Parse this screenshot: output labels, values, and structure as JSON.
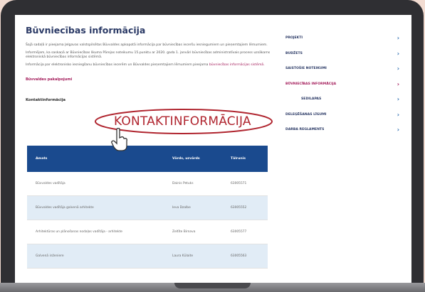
{
  "page": {
    "title": "Būvniecības informācija",
    "paragraph1": "Šajā sadaļā ir pieejama Jelgavas valstspilsētas Būvvaldes apkopotā informācija par būvniecības ieceršu iesniegumiem un pieņemtajiem lēmumiem.",
    "paragraph2": "Informējam, ka saskaņā ar Būvniecības likuma Pārejas noteikumu 15.punktu ar 2020. gada 1. janvāri būvniecības administratīvais process uzsākams elektroniskā būvniecības informācijas sistēmā.",
    "paragraph3_text": "Informācija par elektronisko iesniegšanu būvniecības iecerēm un Būvvaldes pieņemtajiem lēmumiem pieejama ",
    "paragraph3_link": "būvniecības informācijas sistēmā.",
    "rules_link": "Būvvaldes pakalpojumi",
    "contacts_label": "Kontaktinformācija"
  },
  "contacts_table": {
    "headers": [
      "Amats",
      "Vārds, uzvārds",
      "Tālrunis"
    ],
    "rows": [
      [
        "Būvvaldes vadītāja",
        "Dainis Petuks",
        "63005571"
      ],
      [
        "Būvvaldes vadītāja galvenā arhitekte",
        "Ieva Dzalbe",
        "63005552"
      ],
      [
        "Arhitektūras un plānošanas nodaļas vadītāja - arhitekte",
        "Zeltīte Birnava",
        "63005577"
      ],
      [
        "Galvenā inženiere",
        "Laura Kūlaite",
        "63005563"
      ]
    ]
  },
  "sidebar": {
    "items": [
      {
        "label": "PROJEKTI",
        "active": false,
        "sub": false
      },
      {
        "label": "BUDŽETS",
        "active": false,
        "sub": false
      },
      {
        "label": "SAISTOŠIE NOTEIKUMI",
        "active": false,
        "sub": false
      },
      {
        "label": "BŪVNIECĪBAS INFORMĀCIJA",
        "active": true,
        "sub": false
      },
      {
        "label": "SEDILAPAS",
        "active": false,
        "sub": true
      },
      {
        "label": "DELEĢĒŠANAS LĪGUMI",
        "active": false,
        "sub": false
      },
      {
        "label": "DARBA REGLAMENTS",
        "active": false,
        "sub": false
      }
    ]
  },
  "annotation": {
    "label": "KONTAKTINFORMĀCIJA",
    "color": "#b0252f"
  },
  "colors": {
    "accent": "#a41d5b",
    "table_header": "#1a4a8e",
    "title": "#2b3a66",
    "row_alt": "#e1ecf6"
  }
}
